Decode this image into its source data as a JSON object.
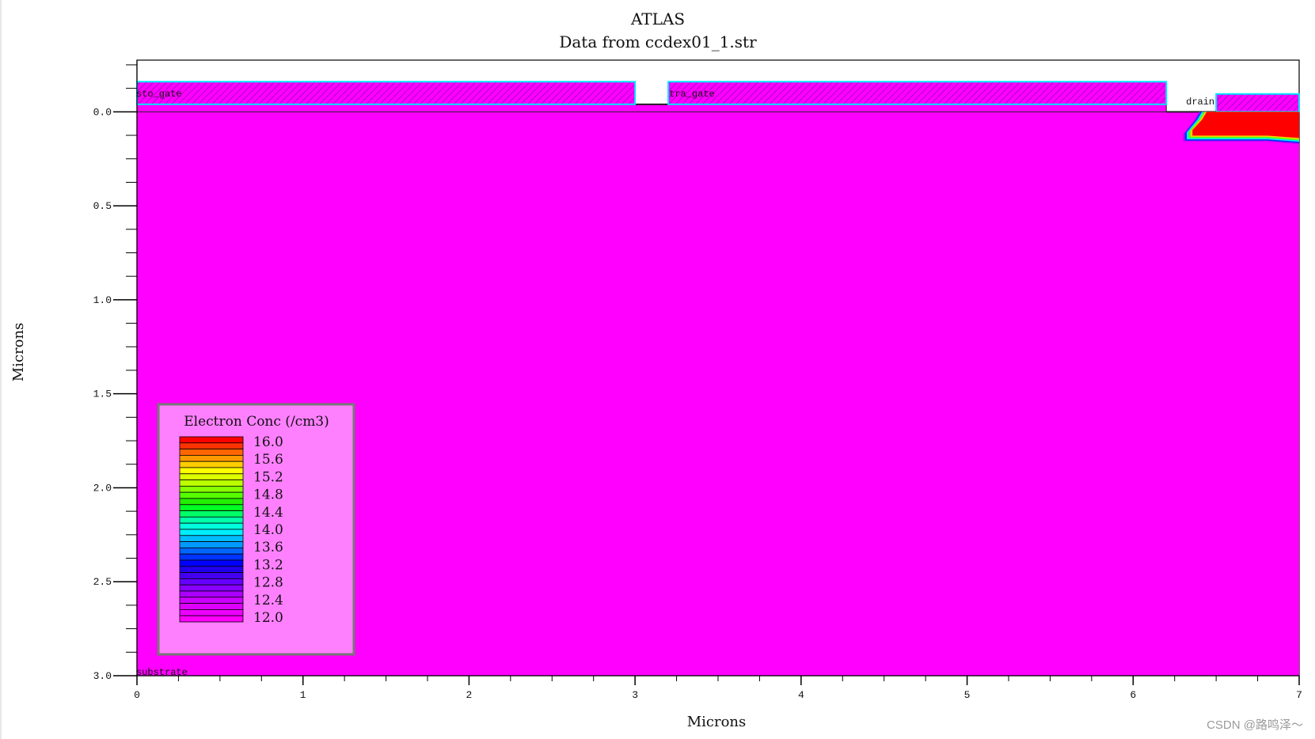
{
  "chart_data": {
    "type": "heatmap",
    "title": "ATLAS",
    "subtitle": "Data from ccdex01_1.str",
    "xlabel": "Microns",
    "ylabel": "Microns",
    "xlim": [
      0,
      7
    ],
    "ylim": [
      3.0,
      -0.275
    ],
    "x_tick_labels": [
      "0",
      "1",
      "2",
      "3",
      "4",
      "5",
      "6",
      "7"
    ],
    "y_tick_labels": [
      "0.0",
      "0.5",
      "1.0",
      "1.5",
      "2.0",
      "2.5",
      "3.0"
    ],
    "y_tick_values": [
      0.0,
      0.5,
      1.0,
      1.5,
      2.0,
      2.5,
      3.0
    ],
    "regions": [
      {
        "name": "sto_gate",
        "kind": "electrode",
        "x_range": [
          0,
          3.0
        ],
        "y_range": [
          -0.16,
          -0.04
        ]
      },
      {
        "name": "tra_gate",
        "kind": "electrode",
        "x_range": [
          3.2,
          6.2
        ],
        "y_range": [
          -0.16,
          -0.04
        ]
      },
      {
        "name": "drain",
        "kind": "electrode",
        "x_range": [
          6.5,
          7.0
        ],
        "y_range": [
          -0.095,
          0.0
        ]
      },
      {
        "name": "substrate",
        "kind": "electrode",
        "x_range": [
          0,
          7.0
        ],
        "y_range": [
          3.0,
          3.0
        ]
      }
    ],
    "oxide_band": {
      "x_range": [
        0,
        6.2
      ],
      "y_range": [
        -0.04,
        0.0
      ]
    },
    "background_level": 12.0,
    "hot_region": {
      "x_range": [
        6.3,
        7.0
      ],
      "y_range": [
        0.0,
        0.16
      ],
      "peak_level": 16.0
    },
    "legend": {
      "title": "Electron Conc (/cm3)",
      "labels": [
        "16.0",
        "15.6",
        "15.2",
        "14.8",
        "14.4",
        "14.0",
        "13.6",
        "13.2",
        "12.8",
        "12.4",
        "12.0"
      ],
      "colors": [
        "#ff0000",
        "#ff3300",
        "#ff6600",
        "#ff9900",
        "#ffcc00",
        "#ffff00",
        "#ddff00",
        "#bbff00",
        "#88ff00",
        "#55ff00",
        "#22ee00",
        "#00ff22",
        "#00ff66",
        "#00ffaa",
        "#00ffdd",
        "#00eeff",
        "#00bbff",
        "#0099ff",
        "#0066ff",
        "#0033ff",
        "#0000ff",
        "#2200ee",
        "#4400ee",
        "#6600ff",
        "#8800ff",
        "#aa00ff",
        "#cc00ff",
        "#dd00ff",
        "#ee00ff",
        "#ff00ff"
      ]
    }
  },
  "colors": {
    "device_fill": "#ff00ff",
    "electrode_border": "#00e5ff",
    "electrode_hatch": "#ff00ff",
    "legend_bg": "#ff80ff",
    "hot": "#ff0000"
  },
  "watermark": "CSDN @路鸣泽～"
}
